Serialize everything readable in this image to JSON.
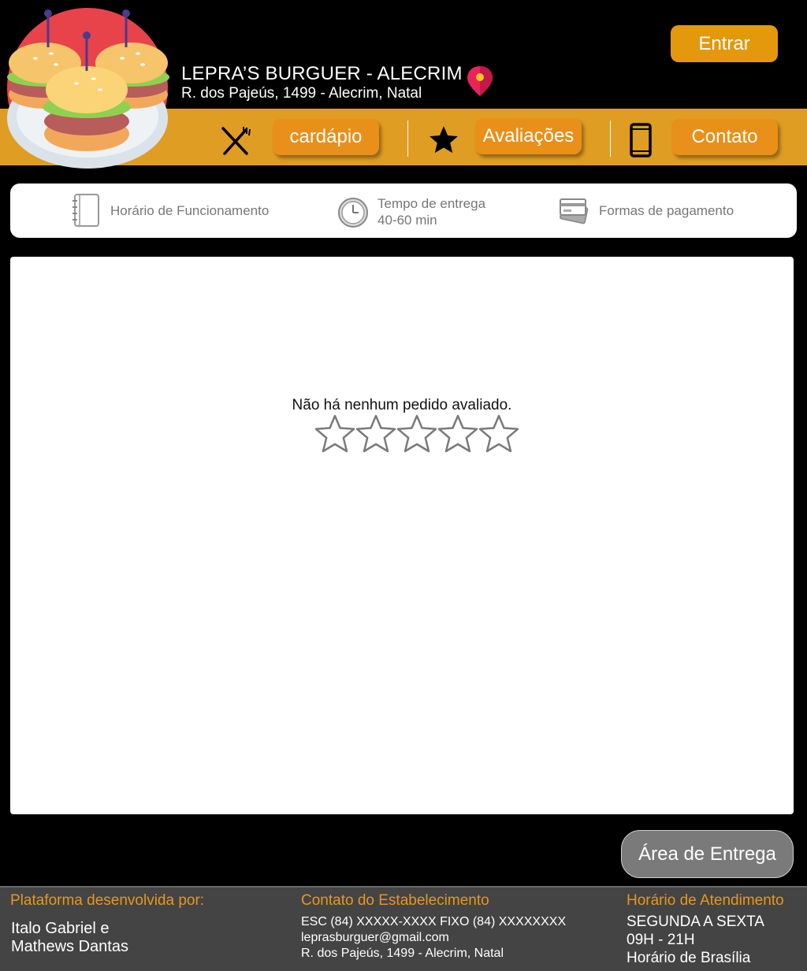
{
  "header": {
    "store_name": "LEPRA’S BURGUER - ALECRIM",
    "store_address": "R. dos Pajeús, 1499 - Alecrim, Natal",
    "login_label": "Entrar"
  },
  "nav": {
    "menu_label": "cardápio",
    "reviews_label": "Avaliações",
    "contact_label": "Contato"
  },
  "info": {
    "hours_label": "Horário de Funcionamento",
    "delivery_time_label": "Tempo de entrega",
    "delivery_time_value": "40-60 min",
    "payment_label": "Formas de pagamento"
  },
  "reviews": {
    "empty_message": "Não há nenhum pedido avaliado.",
    "rating": 0,
    "max_rating": 5
  },
  "delivery_area_label": "Área de Entrega",
  "footer": {
    "platform_heading": "Plataforma desenvolvida por:",
    "developers_line1": "Italo Gabriel e",
    "developers_line2": "Mathews Dantas",
    "contact_heading": "Contato do Estabelecimento",
    "phones": "ESC (84) XXXXX-XXXX FIXO (84) XXXXXXXX",
    "email": "leprasburguer@gmail.com",
    "address": "R. dos Pajeús, 1499 - Alecrim, Natal",
    "hours_heading": "Horário de Atendimento",
    "days": "SEGUNDA A SEXTA",
    "hours": "09H - 21H",
    "timezone": "Horário de Brasília"
  },
  "colors": {
    "accent": "#e09d23",
    "button": "#e8901a",
    "footer_bg": "#444444",
    "footer_heading": "#e8961e"
  }
}
